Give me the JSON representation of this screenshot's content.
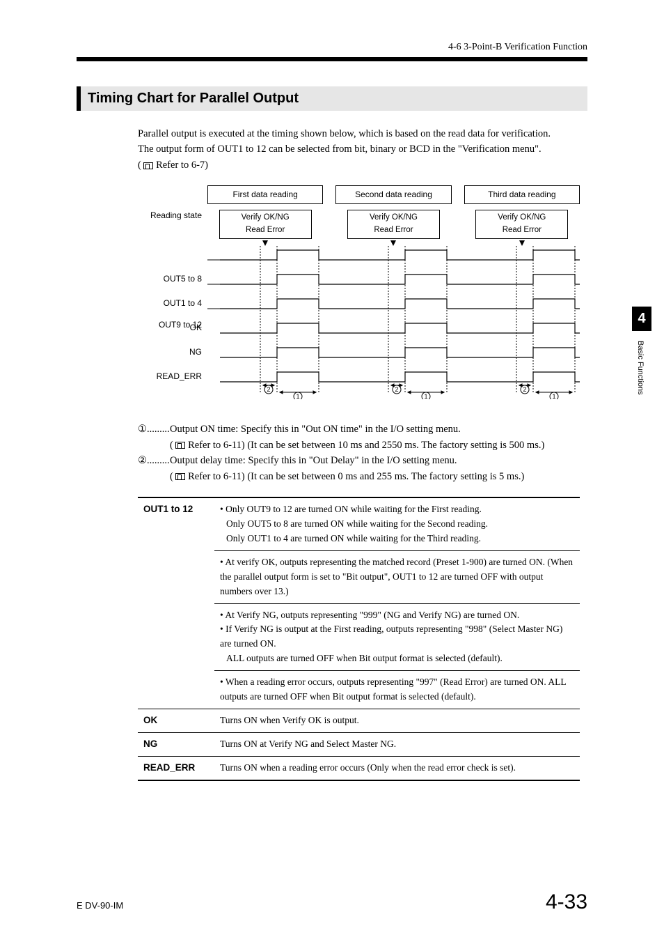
{
  "header": {
    "breadcrumb": "4-6  3-Point-B Verification Function"
  },
  "section": {
    "title": "Timing Chart for Parallel Output"
  },
  "intro": {
    "p1": "Parallel output is executed at the timing shown below, which is based on the read data for verification.",
    "p2": "The output form of OUT1 to 12 can be selected from bit, binary or BCD in the \"Verification menu\".",
    "p3_ref": "Refer to 6-7)"
  },
  "chart": {
    "reading_state": "Reading state",
    "cols": [
      "First data reading",
      "Second data reading",
      "Third data reading"
    ],
    "subbox_l1": "Verify OK/NG",
    "subbox_l2": "Read Error",
    "rows": [
      "OUT9 to 12",
      "OUT5 to 8",
      "OUT1 to 4",
      "OK",
      "NG",
      "READ_ERR"
    ]
  },
  "notes": {
    "n1_tag": "①.........",
    "n1_a": "Output ON time: Specify this in \"Out ON time\" in the I/O setting menu.",
    "n1_b": "Refer to 6-11) (It can be set between 10 ms and 2550 ms. The factory setting is 500 ms.)",
    "n2_tag": "②.........",
    "n2_a": "Output delay time: Specify this in \"Out Delay\" in the I/O setting menu.",
    "n2_b": "Refer to 6-11) (It can be set between 0 ms and 255 ms. The factory setting is 5 ms.)"
  },
  "table": {
    "r1_key": "OUT1 to 12",
    "r1a_1": "• Only OUT9 to 12 are turned ON while waiting for the First reading.",
    "r1a_2": "Only OUT5 to 8 are turned ON while waiting for the Second reading.",
    "r1a_3": "Only OUT1 to 4 are turned ON while waiting for the Third reading.",
    "r1b_1": "• At verify OK, outputs representing the matched record (Preset 1-900) are turned ON. (When the parallel output form is set to \"Bit output\", OUT1 to 12 are turned OFF with output numbers over 13.)",
    "r1c_1": "• At Verify NG, outputs representing \"999\" (NG and Verify NG) are turned ON.",
    "r1c_2": "• If Verify NG is output at the First reading, outputs representing \"998\" (Select Master NG) are turned ON.",
    "r1c_3": "ALL outputs are turned OFF when Bit output format is selected (default).",
    "r1d_1": "• When a reading error occurs, outputs representing \"997\" (Read Error) are turned ON. ALL outputs are turned OFF when Bit output format is selected (default).",
    "r2_key": "OK",
    "r2": "Turns ON when Verify OK is output.",
    "r3_key": "NG",
    "r3": "Turns ON at Verify NG and Select Master NG.",
    "r4_key": "READ_ERR",
    "r4": "Turns ON when a reading error occurs (Only when the read error check is set)."
  },
  "side": {
    "num": "4",
    "label": "Basic Functions"
  },
  "footer": {
    "left": "E DV-90-IM",
    "right": "4-33"
  },
  "chart_data": {
    "type": "timing-diagram",
    "columns": [
      "First data reading",
      "Second data reading",
      "Third data reading"
    ],
    "trigger_event": "Verify OK/NG / Read Error",
    "signals": [
      "OUT9 to 12",
      "OUT5 to 8",
      "OUT1 to 4",
      "OK",
      "NG",
      "READ_ERR"
    ],
    "markers": {
      "1": "Output ON time (Out ON time), 10–2550 ms, default 500 ms",
      "2": "Output delay time (Out Delay), 0–255 ms, default 5 ms"
    },
    "description": "For each reading cycle, after the Verify OK/NG or Read Error decision, outputs go HIGH after delay ② and stay HIGH for ① (Out ON time). OUT groups active depend on reading stage (9-12 / 5-8 / 1-4). OK, NG, READ_ERR follow same timing ②→①."
  }
}
